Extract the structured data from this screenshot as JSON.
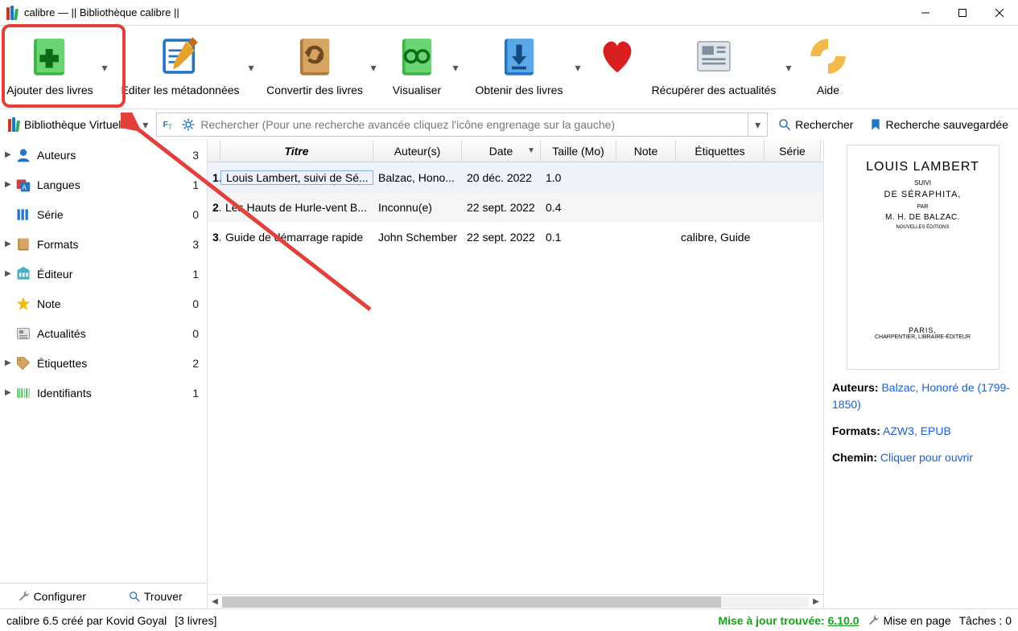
{
  "window": {
    "title": "calibre — || Bibliothèque calibre ||"
  },
  "toolbar": {
    "add": "Ajouter des livres",
    "edit": "Editer les métadonnées",
    "convert": "Convertir des livres",
    "view": "Visualiser",
    "get": "Obtenir des livres",
    "news": "Récupérer des actualités",
    "help": "Aide"
  },
  "search": {
    "vl_label": "Bibliothèque Virtuelle",
    "placeholder": "Rechercher (Pour une recherche avancée cliquez l'icône engrenage sur la gauche)",
    "search_btn": "Rechercher",
    "saved_btn": "Recherche sauvegardée"
  },
  "sidebar": {
    "items": [
      {
        "label": "Auteurs",
        "count": "3",
        "arrow": true
      },
      {
        "label": "Langues",
        "count": "1",
        "arrow": true
      },
      {
        "label": "Série",
        "count": "0",
        "arrow": false
      },
      {
        "label": "Formats",
        "count": "3",
        "arrow": true
      },
      {
        "label": "Éditeur",
        "count": "1",
        "arrow": true
      },
      {
        "label": "Note",
        "count": "0",
        "arrow": false
      },
      {
        "label": "Actualités",
        "count": "0",
        "arrow": false
      },
      {
        "label": "Étiquettes",
        "count": "2",
        "arrow": true
      },
      {
        "label": "Identifiants",
        "count": "1",
        "arrow": true
      }
    ],
    "configure": "Configurer",
    "find": "Trouver"
  },
  "table": {
    "headers": {
      "idx": "",
      "title": "Titre",
      "author": "Auteur(s)",
      "date": "Date",
      "size": "Taille (Mo)",
      "note": "Note",
      "tags": "Étiquettes",
      "series": "Série"
    },
    "rows": [
      {
        "idx": "1",
        "title": "Louis Lambert, suivi de Sé...",
        "author": "Balzac, Hono...",
        "date": "20 déc. 2022",
        "size": "1.0",
        "note": "",
        "tags": "",
        "series": ""
      },
      {
        "idx": "2",
        "title": "Les Hauts de Hurle-vent B...",
        "author": "Inconnu(e)",
        "date": "22 sept. 2022",
        "size": "0.4",
        "note": "",
        "tags": "",
        "series": ""
      },
      {
        "idx": "3",
        "title": "Guide de démarrage rapide",
        "author": "John Schember",
        "date": "22 sept. 2022",
        "size": "0.1",
        "note": "",
        "tags": "calibre, Guide",
        "series": ""
      }
    ]
  },
  "details": {
    "cover": {
      "t1": "LOUIS LAMBERT",
      "t2": "SUIVI",
      "t3": "DE SÉRAPHITA,",
      "t4": "PAR",
      "t5": "M. H. DE BALZAC.",
      "t6": "NOUVELLES ÉDITIONS",
      "t7": "PARIS,",
      "t8": "CHARPENTIER, LIBRAIRE-ÉDITEUR"
    },
    "authors_label": "Auteurs:",
    "authors_value": "Balzac, Honoré de (1799-1850)",
    "formats_label": "Formats:",
    "formats_value": "AZW3, EPUB",
    "path_label": "Chemin:",
    "path_value": "Cliquer pour ouvrir"
  },
  "status": {
    "credit": "calibre 6.5 créé par Kovid Goyal",
    "count": "[3 livres]",
    "update_label": "Mise à jour trouvée:",
    "update_version": "6.10.0",
    "layout": "Mise en page",
    "jobs": "Tâches : 0"
  }
}
